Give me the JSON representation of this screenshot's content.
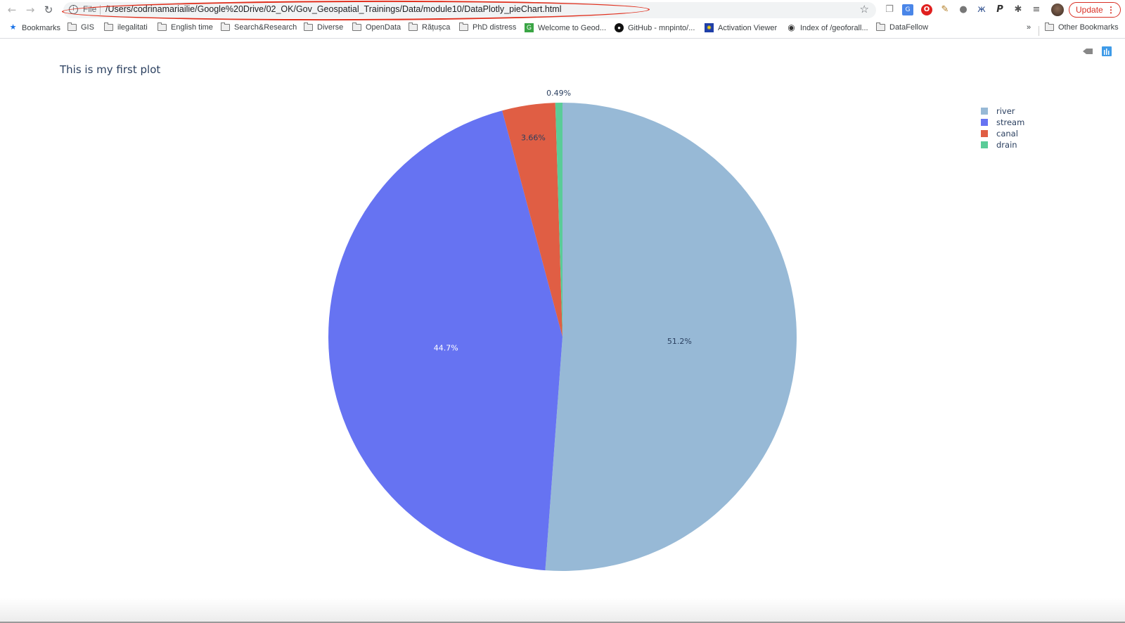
{
  "browser": {
    "address_bar": {
      "scheme_label": "File",
      "url": "/Users/codrinamariailie/Google%20Drive/02_OK/Gov_Geospatial_Trainings/Data/module10/DataPlotly_pieChart.html"
    },
    "update_button_label": "Update",
    "bookmarks": [
      {
        "label": "Bookmarks",
        "icon": "star-icon"
      },
      {
        "label": "GIS",
        "icon": "folder-icon"
      },
      {
        "label": "ilegalitati",
        "icon": "folder-icon"
      },
      {
        "label": "English time",
        "icon": "folder-icon"
      },
      {
        "label": "Search&Research",
        "icon": "folder-icon"
      },
      {
        "label": "Diverse",
        "icon": "folder-icon"
      },
      {
        "label": "OpenData",
        "icon": "folder-icon"
      },
      {
        "label": "Rățușca",
        "icon": "folder-icon"
      },
      {
        "label": "PhD distress",
        "icon": "folder-icon"
      },
      {
        "label": "Welcome to Geod...",
        "icon": "geodata-icon"
      },
      {
        "label": "GitHub - mnpinto/...",
        "icon": "github-icon"
      },
      {
        "label": "Activation Viewer",
        "icon": "eu-flag-icon"
      },
      {
        "label": "Index of /geoforall...",
        "icon": "globe-icon"
      },
      {
        "label": "DataFellow",
        "icon": "folder-icon"
      }
    ],
    "overflow_label": "»",
    "other_bookmarks_label": "Other Bookmarks"
  },
  "chart_data": {
    "type": "pie",
    "title": "This is my first plot",
    "labels": [
      "river",
      "stream",
      "canal",
      "drain"
    ],
    "values": [
      51.2,
      44.7,
      3.66,
      0.49
    ],
    "text_labels": [
      "51.2%",
      "44.7%",
      "3.66%",
      "0.49%"
    ],
    "colors": [
      "#97b9d6",
      "#6673f2",
      "#e05e44",
      "#5acc98"
    ],
    "direction": "clockwise",
    "start_angle_deg": 90,
    "legend": {
      "position": "top-right",
      "entries": [
        "river",
        "stream",
        "canal",
        "drain"
      ]
    }
  }
}
